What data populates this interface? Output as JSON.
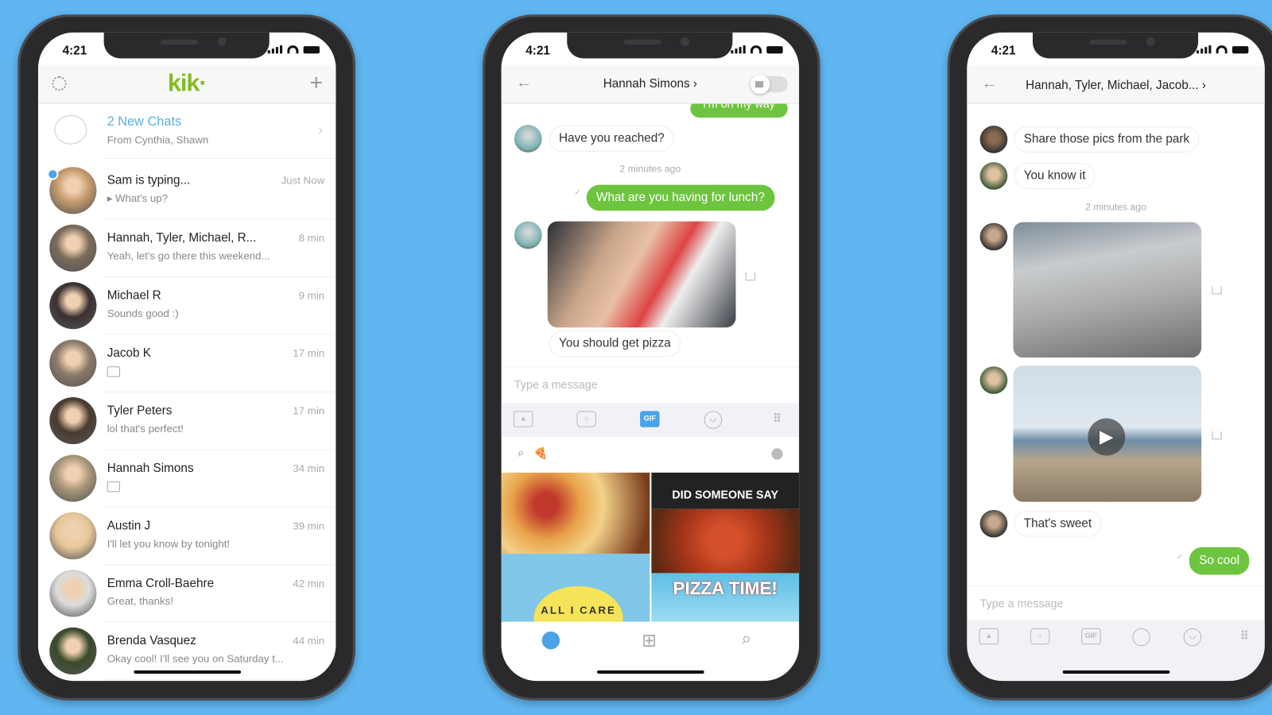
{
  "colors": {
    "background": "#60b6f1",
    "kik_green": "#82bc23",
    "bubble_green": "#6dc43e",
    "link_blue": "#5ab0e0",
    "gif_active": "#4aa3e8"
  },
  "status": {
    "time": "4:21"
  },
  "phone1": {
    "logo": "kik·",
    "icons": {
      "left": "gear-icon",
      "right": "plus-icon"
    },
    "new_chats": {
      "title": "2 New Chats",
      "subtitle": "From Cynthia, Shawn"
    },
    "chats": [
      {
        "name": "Sam is typing...",
        "preview": "▸ What's up?",
        "time": "Just Now",
        "unread": true
      },
      {
        "name": "Hannah, Tyler, Michael, R...",
        "preview": "Yeah, let's go there this weekend...",
        "time": "8 min"
      },
      {
        "name": "Michael R",
        "preview": "Sounds good :)",
        "time": "9 min"
      },
      {
        "name": "Jacob K",
        "preview": "",
        "time": "17 min"
      },
      {
        "name": "Tyler Peters",
        "preview": "lol that's perfect!",
        "time": "17 min"
      },
      {
        "name": "Hannah Simons",
        "preview": "",
        "time": "34 min"
      },
      {
        "name": "Austin J",
        "preview": "I'll let you know by tonight!",
        "time": "39 min"
      },
      {
        "name": "Emma Croll-Baehre",
        "preview": "Great, thanks!",
        "time": "42 min"
      },
      {
        "name": "Brenda Vasquez",
        "preview": "Okay cool! I'll see you on Saturday t...",
        "time": "44 min"
      }
    ]
  },
  "phone2": {
    "title": "Hannah Simons ›",
    "messages": {
      "partial": "I'm on my way",
      "m1": "Have you reached?",
      "stamp": "2 minutes ago",
      "m2": "What are you having for lunch?",
      "m3": "You should get pizza"
    },
    "input_placeholder": "Type a message",
    "toolbar": {
      "gif": "GIF"
    },
    "search_value": "🍕",
    "gifs": {
      "g2": "DID SOMEONE SAY",
      "g3": "ALL I CARE",
      "g4": "PIZZA TIME!"
    }
  },
  "phone3": {
    "title": "Hannah, Tyler, Michael, Jacob... ›",
    "messages": {
      "m1": "Share those pics from the park",
      "m2": "You know it",
      "stamp": "2 minutes ago",
      "m3": "That's sweet",
      "m4": "So cool"
    },
    "input_placeholder": "Type a message",
    "toolbar": {
      "gif": "GIF"
    }
  }
}
